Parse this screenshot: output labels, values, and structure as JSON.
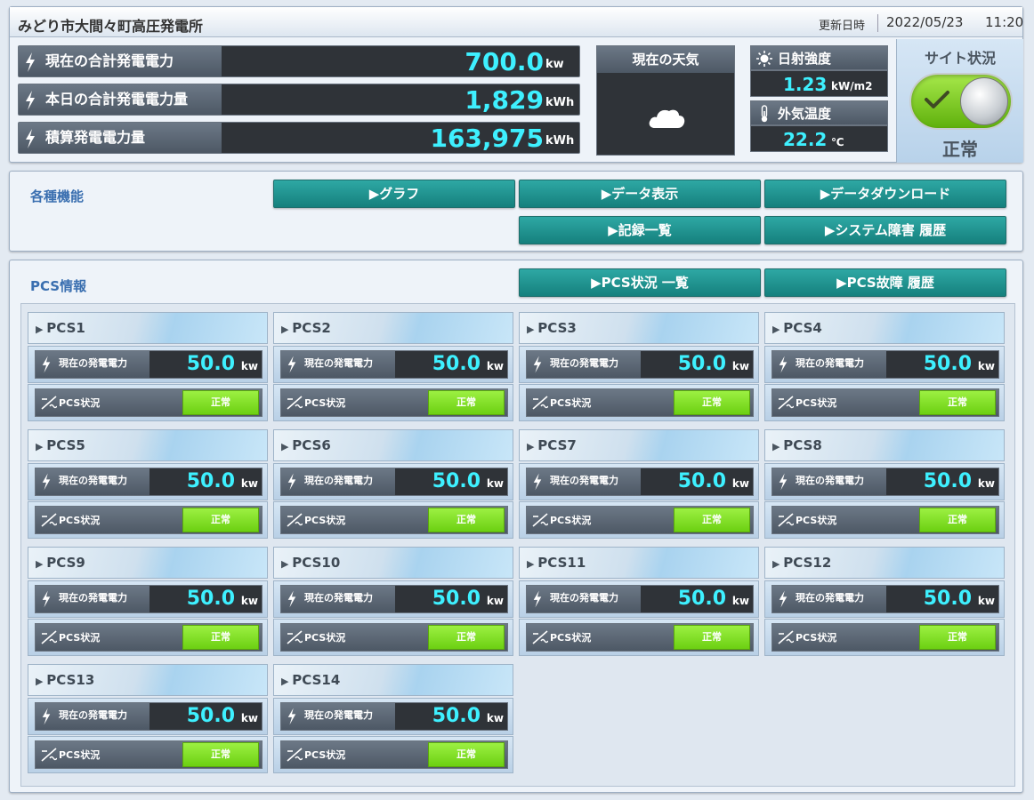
{
  "header": {
    "site_name": "みどり市大間々町高圧発電所",
    "updated_label": "更新日時",
    "updated_date": "2022/05/23",
    "updated_time": "11:20"
  },
  "stats": [
    {
      "label": "現在の合計発電電力",
      "value": "700.0",
      "unit": "kw"
    },
    {
      "label": "本日の合計発電電力量",
      "value": "1,829",
      "unit": "kWh"
    },
    {
      "label": "積算発電電力量",
      "value": "163,975",
      "unit": "kWh"
    }
  ],
  "weather": {
    "title": "現在の天気",
    "icon": "cloud-icon"
  },
  "environment": {
    "irradiance_label": "日射強度",
    "irradiance_value": "1.23",
    "irradiance_unit": "kW/m2",
    "temp_label": "外気温度",
    "temp_value": "22.2",
    "temp_unit": "℃"
  },
  "site_status": {
    "title": "サイト状況",
    "text": "正常",
    "toggle_on": true
  },
  "functions": {
    "title": "各種機能",
    "buttons": [
      "▶グラフ",
      "▶データ表示",
      "▶データダウンロード",
      "▶記録一覧",
      "▶システム障害 履歴"
    ]
  },
  "pcs": {
    "title": "PCS情報",
    "buttons": [
      "▶PCS状況 一覧",
      "▶PCS故障 履歴"
    ],
    "power_label": "現在の発電電力",
    "status_label": "PCS状況",
    "units": [
      {
        "name": "PCS1",
        "value": "50.0",
        "unit": "kw",
        "status": "正常"
      },
      {
        "name": "PCS2",
        "value": "50.0",
        "unit": "kw",
        "status": "正常"
      },
      {
        "name": "PCS3",
        "value": "50.0",
        "unit": "kw",
        "status": "正常"
      },
      {
        "name": "PCS4",
        "value": "50.0",
        "unit": "kw",
        "status": "正常"
      },
      {
        "name": "PCS5",
        "value": "50.0",
        "unit": "kw",
        "status": "正常"
      },
      {
        "name": "PCS6",
        "value": "50.0",
        "unit": "kw",
        "status": "正常"
      },
      {
        "name": "PCS7",
        "value": "50.0",
        "unit": "kw",
        "status": "正常"
      },
      {
        "name": "PCS8",
        "value": "50.0",
        "unit": "kw",
        "status": "正常"
      },
      {
        "name": "PCS9",
        "value": "50.0",
        "unit": "kw",
        "status": "正常"
      },
      {
        "name": "PCS10",
        "value": "50.0",
        "unit": "kw",
        "status": "正常"
      },
      {
        "name": "PCS11",
        "value": "50.0",
        "unit": "kw",
        "status": "正常"
      },
      {
        "name": "PCS12",
        "value": "50.0",
        "unit": "kw",
        "status": "正常"
      },
      {
        "name": "PCS13",
        "value": "50.0",
        "unit": "kw",
        "status": "正常"
      },
      {
        "name": "PCS14",
        "value": "50.0",
        "unit": "kw",
        "status": "正常"
      }
    ]
  },
  "colors": {
    "value_cyan": "#3ef0ff",
    "teal_button": "#1f9490",
    "status_green": "#7ddf20",
    "title_blue": "#3a6fb0"
  }
}
